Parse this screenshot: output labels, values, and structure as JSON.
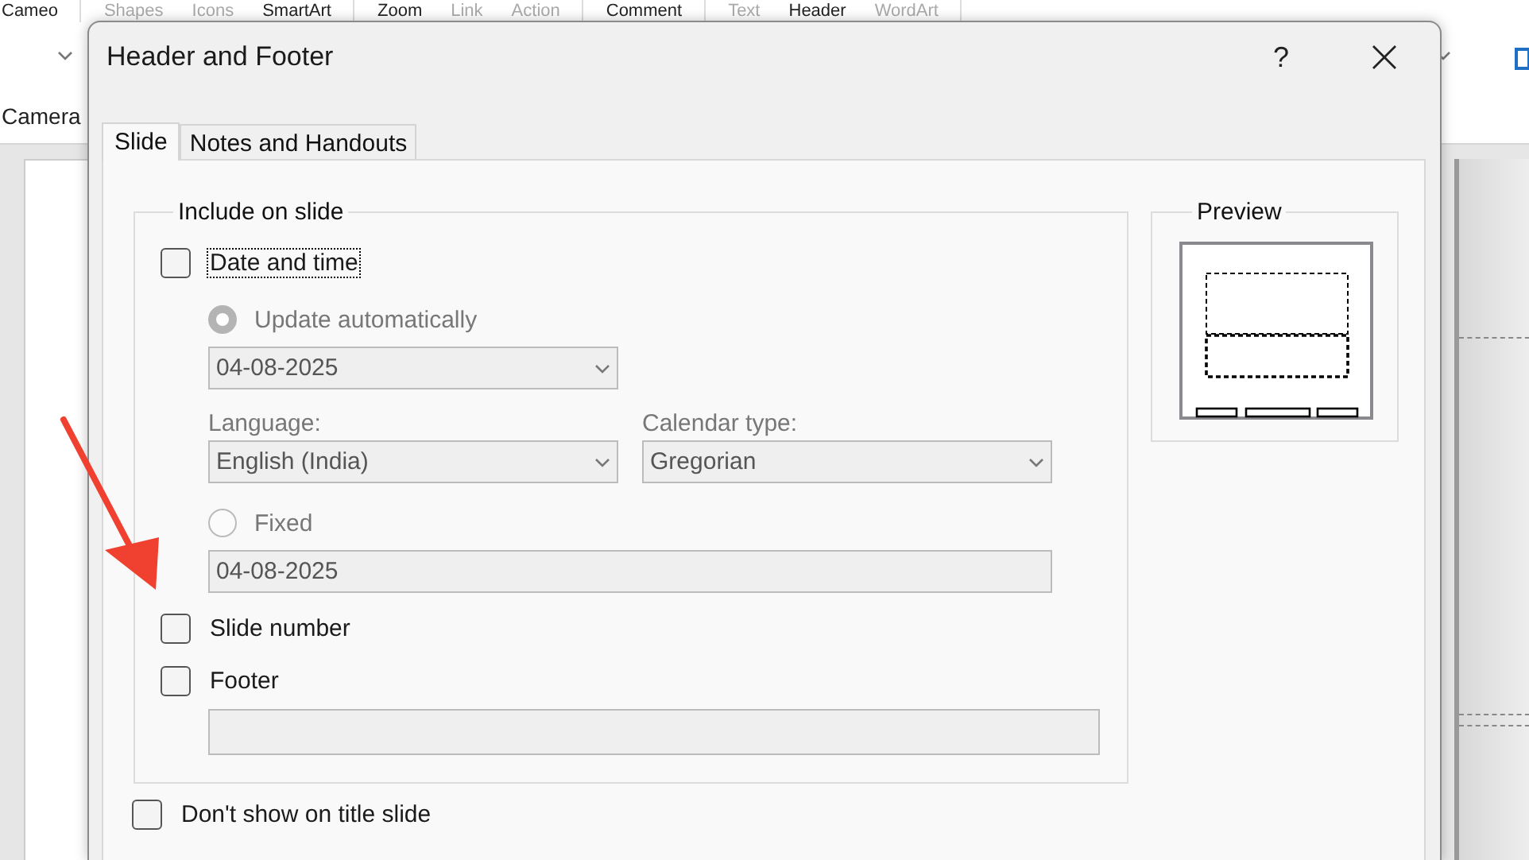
{
  "ribbon": {
    "groups": [
      {
        "items": [
          {
            "label": "Cameo",
            "disabled": false
          }
        ]
      },
      {
        "items": [
          {
            "label": "Shapes",
            "disabled": true
          },
          {
            "label": "Icons",
            "disabled": true
          },
          {
            "label": "SmartArt",
            "disabled": false
          }
        ]
      },
      {
        "items": [
          {
            "label": "Zoom",
            "disabled": false
          },
          {
            "label": "Link",
            "disabled": true
          },
          {
            "label": "Action",
            "disabled": true
          }
        ]
      },
      {
        "items": [
          {
            "label": "Comment",
            "disabled": false
          }
        ]
      },
      {
        "items": [
          {
            "label": "Text",
            "disabled": true
          },
          {
            "label": "Header",
            "disabled": false
          },
          {
            "label": "WordArt",
            "disabled": true
          }
        ]
      }
    ],
    "group_label": "Camera"
  },
  "dialog": {
    "title": "Header and Footer",
    "help": "?",
    "tabs": [
      {
        "label": "Slide",
        "selected": true
      },
      {
        "label": "Notes and Handouts",
        "selected": false
      }
    ],
    "include_group": {
      "title": "Include on slide",
      "date_and_time": {
        "label": "Date and time",
        "checked": false,
        "focused": true
      },
      "update_automatically": {
        "label": "Update automatically",
        "selected": true,
        "disabled": true
      },
      "auto_date": {
        "value": "04-08-2025",
        "disabled": true
      },
      "language": {
        "label": "Language:",
        "value": "English (India)",
        "disabled": true
      },
      "calendar_type": {
        "label": "Calendar type:",
        "value": "Gregorian",
        "disabled": true
      },
      "fixed": {
        "label": "Fixed",
        "selected": false,
        "disabled": true
      },
      "fixed_date": {
        "value": "04-08-2025",
        "disabled": true
      },
      "slide_number": {
        "label": "Slide number",
        "checked": false
      },
      "footer": {
        "label": "Footer",
        "checked": false
      },
      "footer_text": {
        "disabled": true
      }
    },
    "dont_show_on_title_slide": {
      "label": "Don't show on title slide",
      "checked": false
    },
    "preview": {
      "title": "Preview"
    }
  }
}
